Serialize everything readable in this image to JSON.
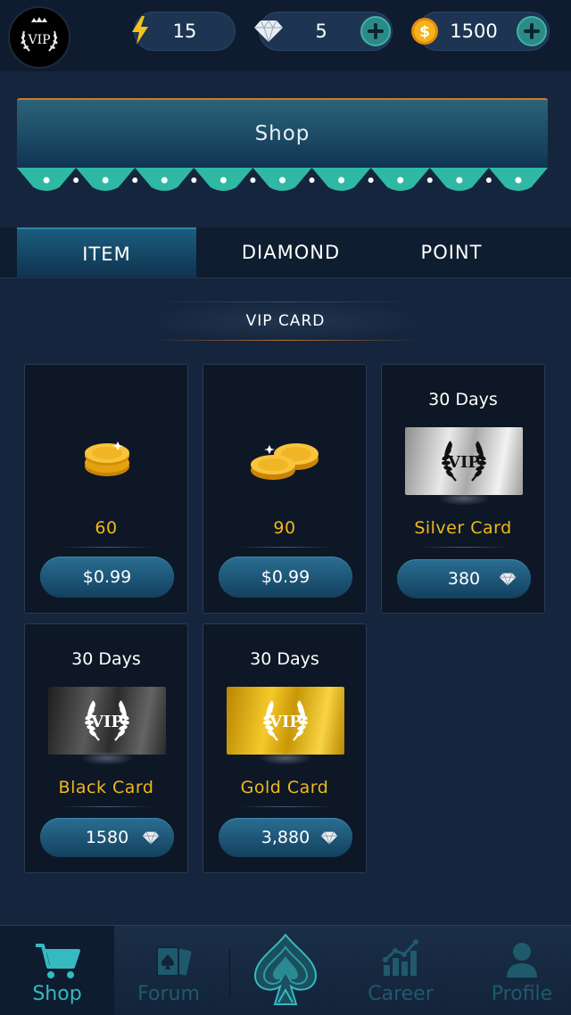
{
  "topbar": {
    "vip_badge_text": "VIP",
    "energy": "15",
    "diamonds": "5",
    "coins": "1500"
  },
  "banner": {
    "title": "Shop"
  },
  "tabs": [
    {
      "label": "ITEM",
      "active": true
    },
    {
      "label": "DIAMOND",
      "active": false
    },
    {
      "label": "POINT",
      "active": false
    }
  ],
  "section": {
    "title": "VIP CARD"
  },
  "products": [
    {
      "caption": "",
      "name": "60",
      "price": "$0.99",
      "currency": "usd",
      "image": "coin-stack-icon"
    },
    {
      "caption": "",
      "name": "90",
      "price": "$0.99",
      "currency": "usd",
      "image": "coin-pile-icon"
    },
    {
      "caption": "30 Days",
      "name": "Silver Card",
      "price": "380",
      "currency": "diamond",
      "image": "vip-silver-card"
    },
    {
      "caption": "30 Days",
      "name": "Black Card",
      "price": "1580",
      "currency": "diamond",
      "image": "vip-black-card"
    },
    {
      "caption": "30 Days",
      "name": "Gold Card",
      "price": "3,880",
      "currency": "diamond",
      "image": "vip-gold-card"
    }
  ],
  "vip_plate_text": "VIP",
  "nav": [
    {
      "label": "Shop",
      "icon": "cart-icon",
      "active": true
    },
    {
      "label": "Forum",
      "icon": "cards-icon",
      "active": false
    },
    {
      "label": "",
      "icon": "spade-logo-icon",
      "active": false
    },
    {
      "label": "Career",
      "icon": "chart-icon",
      "active": false
    },
    {
      "label": "Profile",
      "icon": "person-icon",
      "active": false
    }
  ],
  "colors": {
    "accent_teal": "#36b9c1",
    "gold_text": "#f0b81b",
    "background": "#15253d"
  }
}
